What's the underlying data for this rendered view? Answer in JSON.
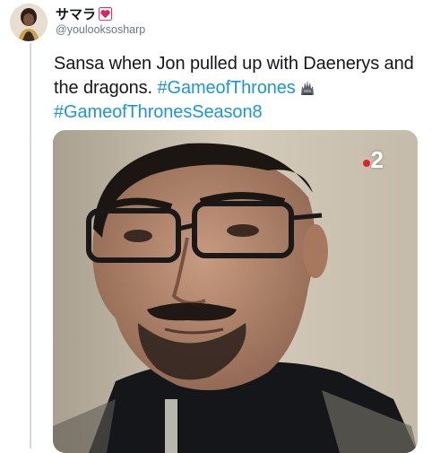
{
  "author": {
    "display_name": "サマラ",
    "handle": "@youlooksosharp",
    "avatar_icon": "avatar-icon",
    "emoji_icon": "heart-icon"
  },
  "tweet": {
    "text_main": "Sansa when Jon pulled up with Daenerys and the dragons.",
    "hashtag_1": "#GameofThrones",
    "hashtag_2": "#GameofThronesSeason8",
    "emoji_icon": "iron-throne-icon"
  },
  "media": {
    "channel_badge": "2",
    "description_icon": "video-still-icon"
  },
  "colors": {
    "hashtag": "#1b95e0",
    "text": "#14171a",
    "secondary": "#657786",
    "thread_line": "#cfd9de",
    "heart": "#e0245e"
  }
}
